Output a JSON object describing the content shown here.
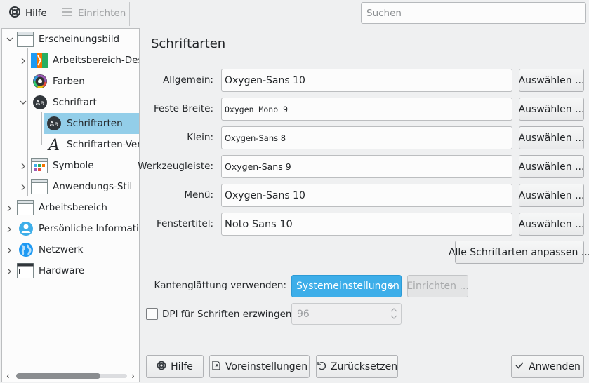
{
  "toolbar": {
    "help_label": "Hilfe",
    "configure_label": "Einrichten"
  },
  "search": {
    "placeholder": "Suchen"
  },
  "sidebar": {
    "items": [
      {
        "label": "Erscheinungsbild",
        "icon": "window-icon"
      },
      {
        "label": "Arbeitsbereich-Design",
        "icon": "workspace-theme-icon"
      },
      {
        "label": "Farben",
        "icon": "color-wheel-icon"
      },
      {
        "label": "Schriftart",
        "icon": "font-icon"
      },
      {
        "label": "Schriftarten",
        "icon": "font-icon"
      },
      {
        "label": "Schriftarten-Verwaltung",
        "icon": "font-letter-icon"
      },
      {
        "label": "Symbole",
        "icon": "icons-icon"
      },
      {
        "label": "Anwendungs-Stil",
        "icon": "window-icon"
      },
      {
        "label": "Arbeitsbereich",
        "icon": "window-icon"
      },
      {
        "label": "Persönliche Informationen",
        "icon": "user-icon"
      },
      {
        "label": "Netzwerk",
        "icon": "globe-icon"
      },
      {
        "label": "Hardware",
        "icon": "hardware-icon"
      }
    ]
  },
  "main": {
    "title": "Schriftarten",
    "fonts": [
      {
        "label": "Allgemein:",
        "value": "Oxygen-Sans 10"
      },
      {
        "label": "Feste Breite:",
        "value": "Oxygen Mono 9"
      },
      {
        "label": "Klein:",
        "value": "Oxygen-Sans 8"
      },
      {
        "label": "Werkzeugleiste:",
        "value": "Oxygen-Sans 9"
      },
      {
        "label": "Menü:",
        "value": "Oxygen-Sans 10"
      },
      {
        "label": "Fenstertitel:",
        "value": "Noto Sans 10"
      }
    ],
    "select_label": "Auswählen ...",
    "adjust_all_label": "Alle Schriftarten anpassen ...",
    "antialias_label": "Kantenglättung verwenden:",
    "antialias_value": "Systemeinstellungen",
    "antialias_configure_label": "Einrichten ...",
    "dpi_label": "DPI für Schriften erzwingen:",
    "dpi_value": "96"
  },
  "footer": {
    "help_label": "Hilfe",
    "defaults_label": "Voreinstellungen",
    "reset_label": "Zurücksetzen",
    "apply_label": "Anwenden"
  },
  "colors": {
    "accent": "#3daee9",
    "selection": "#93cee9",
    "background": "#eff0f1"
  }
}
